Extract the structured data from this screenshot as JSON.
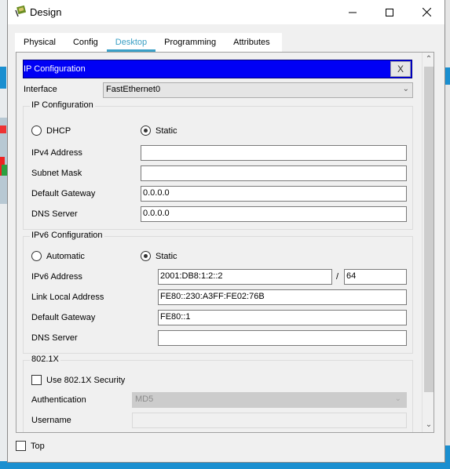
{
  "window": {
    "title": "Design",
    "controls": {
      "minimize": "minimize",
      "maximize": "maximize",
      "close": "close"
    }
  },
  "tabs": [
    {
      "label": "Physical",
      "active": false
    },
    {
      "label": "Config",
      "active": false
    },
    {
      "label": "Desktop",
      "active": true
    },
    {
      "label": "Programming",
      "active": false
    },
    {
      "label": "Attributes",
      "active": false
    }
  ],
  "ip_config": {
    "header_title": "IP Configuration",
    "close_label": "X",
    "interface_label": "Interface",
    "interface_value": "FastEthernet0",
    "ipv4": {
      "group_label": "IP Configuration",
      "dhcp_label": "DHCP",
      "static_label": "Static",
      "mode": "Static",
      "fields": [
        {
          "label": "IPv4 Address",
          "value": ""
        },
        {
          "label": "Subnet Mask",
          "value": ""
        },
        {
          "label": "Default Gateway",
          "value": "0.0.0.0"
        },
        {
          "label": "DNS Server",
          "value": "0.0.0.0"
        }
      ]
    },
    "ipv6": {
      "group_label": "IPv6 Configuration",
      "automatic_label": "Automatic",
      "static_label": "Static",
      "mode": "Static",
      "address_label": "IPv6 Address",
      "address_value": "2001:DB8:1:2::2",
      "prefix_separator": "/",
      "prefix_value": "64",
      "link_local_label": "Link Local Address",
      "link_local_value": "FE80::230:A3FF:FE02:76B",
      "gateway_label": "Default Gateway",
      "gateway_value": "FE80::1",
      "dns_label": "DNS Server",
      "dns_value": ""
    },
    "dot1x": {
      "group_label": "802.1X",
      "use_security_label": "Use 802.1X Security",
      "use_security_checked": false,
      "authentication_label": "Authentication",
      "authentication_value": "MD5",
      "username_label": "Username",
      "username_value": ""
    }
  },
  "footer": {
    "top_label": "Top",
    "top_checked": false
  }
}
